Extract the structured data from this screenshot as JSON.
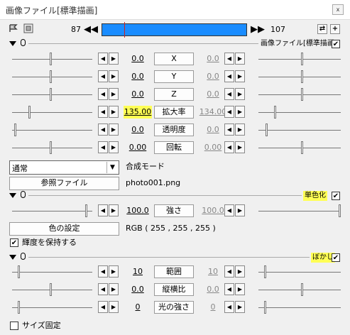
{
  "window": {
    "title": "画像ファイル[標準描画]",
    "close_label": "x"
  },
  "nav": {
    "start_frame": "87",
    "end_frame": "107",
    "sync_icon": "⇄",
    "add_icon": "+"
  },
  "sections": {
    "standard": {
      "title": "画像ファイル[標準描画]",
      "checked": true
    },
    "mono": {
      "title": "単色化",
      "checked": true
    },
    "blur": {
      "title": "ぼかし",
      "checked": true
    }
  },
  "params": [
    {
      "label": "X",
      "left": "0.0",
      "right": "0.0",
      "highlight": false
    },
    {
      "label": "Y",
      "left": "0.0",
      "right": "0.0",
      "highlight": false
    },
    {
      "label": "Z",
      "left": "0.0",
      "right": "0.0",
      "highlight": false
    },
    {
      "label": "拡大率",
      "left": "135.00",
      "right": "134.00",
      "highlight": true
    },
    {
      "label": "透明度",
      "left": "0.0",
      "right": "0.0",
      "highlight": false
    },
    {
      "label": "回転",
      "left": "0.00",
      "right": "0.00",
      "highlight": false
    }
  ],
  "blend": {
    "value": "通常",
    "label": "合成モード"
  },
  "file": {
    "button_label": "参照ファイル",
    "filename": "photo001.png"
  },
  "mono": {
    "strength_label": "強さ",
    "left": "100.0",
    "right": "100.0",
    "color_button": "色の設定",
    "rgb_text": "RGB ( 255 , 255 , 255 )",
    "keep_brightness": "輝度を保持する",
    "keep_checked": true
  },
  "blur": {
    "params": [
      {
        "label": "範囲",
        "left": "10",
        "right": "10"
      },
      {
        "label": "縦横比",
        "left": "0.0",
        "right": "0.0"
      },
      {
        "label": "光の強さ",
        "left": "0",
        "right": "0"
      }
    ],
    "fixed_size": "サイズ固定",
    "fixed_checked": false
  }
}
